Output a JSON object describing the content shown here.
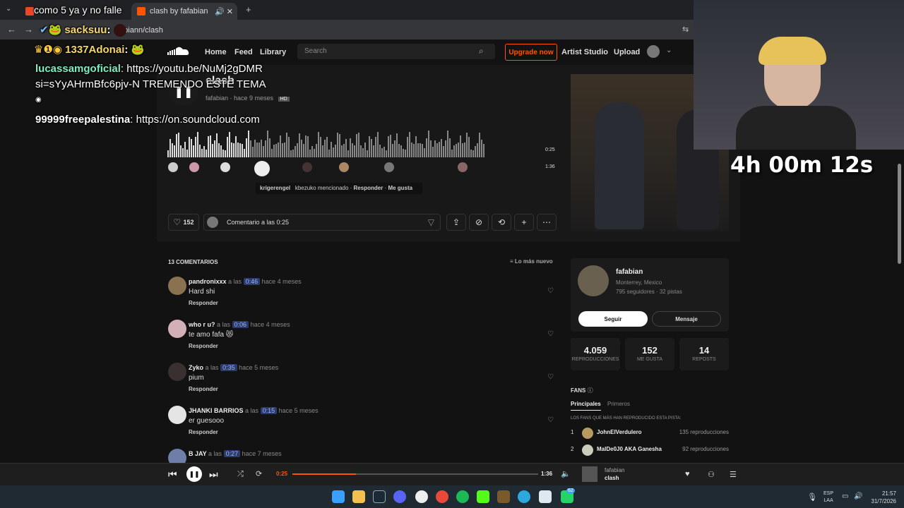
{
  "browser": {
    "tab1": "como 5 ya y no falle",
    "tab2": "clash by fafabian",
    "url": "fabiann/clash"
  },
  "nav": {
    "home": "Home",
    "feed": "Feed",
    "library": "Library",
    "search_placeholder": "Search",
    "upgrade": "Upgrade now",
    "artist_studio": "Artist Studio",
    "upload": "Upload"
  },
  "track": {
    "title": "clash",
    "artist": "fafabian",
    "ago": "hace 9 meses",
    "quality": "HD",
    "elapsed": "0:25",
    "duration": "1:36",
    "progress": 0.26
  },
  "wave_comment": {
    "user": "krigerengel",
    "text": "kbezuko mencionado",
    "reply": "Responder",
    "like": "Me gusta"
  },
  "actions": {
    "likes": "152",
    "comment_placeholder": "Comentario a las 0:25"
  },
  "comments": {
    "header": "13 COMENTARIOS",
    "sort": "Lo más nuevo",
    "at": "a las",
    "reply": "Responder",
    "items": [
      {
        "user": "pandronixxx",
        "time": "0:46",
        "ago": "hace 4 meses",
        "text": "Hard shi"
      },
      {
        "user": "who r u?",
        "time": "0:06",
        "ago": "hace 4 meses",
        "text": "te amo fafa 😻"
      },
      {
        "user": "Zyko",
        "time": "0:35",
        "ago": "hace 5 meses",
        "text": "pium"
      },
      {
        "user": "JHANKI BARRIOS",
        "time": "0:15",
        "ago": "hace 5 meses",
        "text": "er guesooo"
      },
      {
        "user": "B JAY",
        "time": "0:27",
        "ago": "hace 7 meses",
        "text": ""
      }
    ]
  },
  "artist": {
    "name": "fafabian",
    "location": "Monterrey, Mexico",
    "followers": "795 seguidores · 32 pistas",
    "follow": "Seguir",
    "message": "Mensaje"
  },
  "stats": [
    {
      "value": "4.059",
      "label": "REPRODUCCIONES"
    },
    {
      "value": "152",
      "label": "ME GUSTA"
    },
    {
      "value": "14",
      "label": "REPOSTS"
    }
  ],
  "fans": {
    "header": "FANS",
    "tab_main": "Principales",
    "tab_first": "Primeros",
    "subtitle": "LOS FANS QUE MÁS HAN REPRODUCIDO ESTA PISTA:",
    "items": [
      {
        "rank": "1",
        "name": "JohnElVerdulero",
        "plays": "135 reproducciones"
      },
      {
        "rank": "2",
        "name": "MalDe0J0 AKA Ganesha",
        "plays": "92 reproducciones"
      }
    ]
  },
  "player": {
    "elapsed": "0:25",
    "duration": "1:36",
    "artist": "fafabian",
    "title": "clash",
    "progress": 0.26
  },
  "stream": {
    "timer": "4h 00m 12s"
  },
  "chat": [
    {
      "user": "sacksuu",
      "text": ""
    },
    {
      "user": "1337Adonai",
      "text": ""
    },
    {
      "user": "lucassamgoficial",
      "text": "https://youtu.be/NuMj2gDMR"
    },
    {
      "user": "",
      "text": "si=sYyAHrmBfc6pjv-N TREMENDO ESTE TEMA"
    },
    {
      "user": "99999freepalestina",
      "text": "https://on.soundcloud.com"
    }
  ],
  "taskbar": {
    "lang1": "ESP",
    "lang2": "LAA",
    "time": "21:57",
    "date": "31/7/2026",
    "badge": "62"
  }
}
